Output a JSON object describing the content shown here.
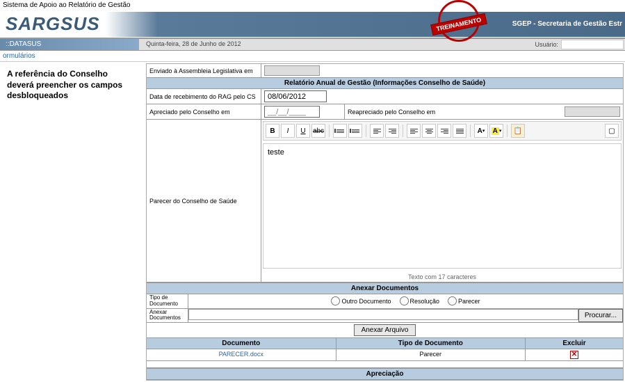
{
  "system_title": "Sistema de Apoio ao Relatório de Gestão",
  "logo": "SARGSUS",
  "stamp": "TREINAMENTO",
  "header_right": "SGEP - Secretaria de Gestão Estr",
  "datasus": "DATASUS",
  "date_display": "Quinta-feira, 28 de Junho de 2012",
  "user_label": "Usuário:",
  "formularios": "ormulários",
  "side_note": "A referência do Conselho deverá preencher os campos desbloqueados",
  "row_enviado": "Enviado à Assembleia Legislativa em",
  "section_header": "Relatório Anual de Gestão (Informações Conselho de Saúde)",
  "row_recebimento": "Data de recebimento do RAG pelo CS",
  "date_value": "08/06/2012",
  "row_apreciado": "Apreciado pelo Conselho em",
  "slash_placeholder": "__/__/____",
  "row_reapreciado": "Reapreciado pelo Conselho em",
  "editor_label": "Parecer do Conselho de Saúde",
  "editor_content": "teste",
  "char_count": "Texto com 17 caracteres",
  "anexar_header": "Anexar Documentos",
  "tipo_label": "Tipo de Documento",
  "radio_options": {
    "outro": "Outro Documento",
    "resolucao": "Resolução",
    "parecer": "Parecer"
  },
  "anexar_label": "Anexar Documentos",
  "browse_btn": "Procurar...",
  "anexar_btn": "Anexar Arquivo",
  "doc_headers": {
    "doc": "Documento",
    "tipo": "Tipo de Documento",
    "excluir": "Excluir"
  },
  "doc_row": {
    "name": "PARECER.docx",
    "tipo": "Parecer"
  },
  "apreciacao_header": "Apreciação",
  "toolbar_labels": {
    "bold": "B",
    "italic": "I",
    "underline": "U",
    "strike": "abc",
    "color_a": "A",
    "hilite_a": "A"
  }
}
